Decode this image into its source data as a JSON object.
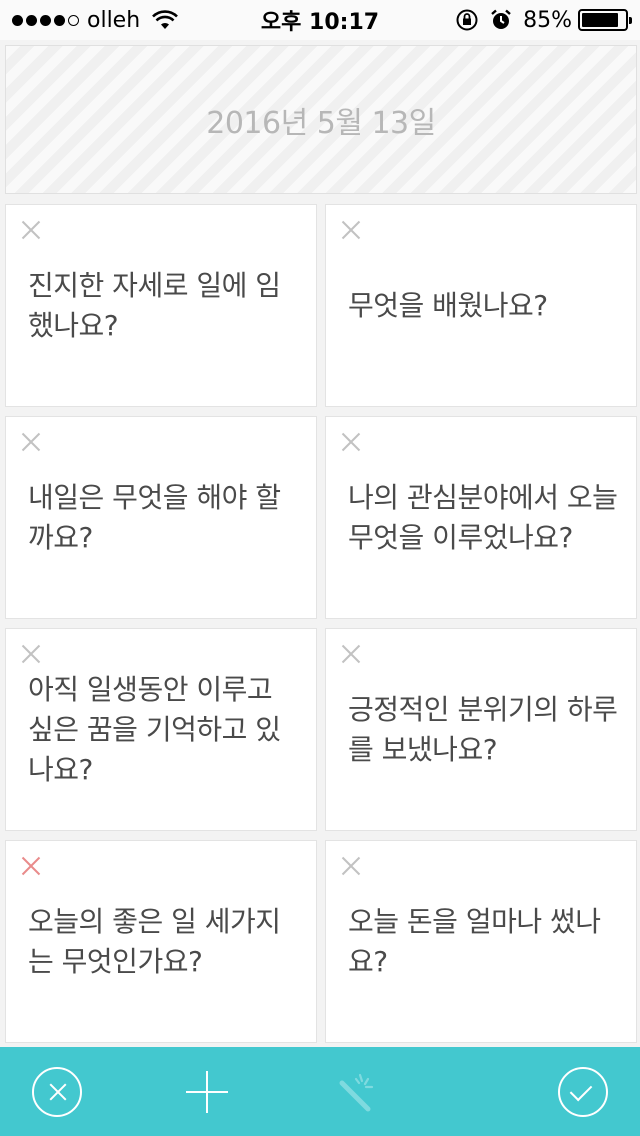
{
  "status_bar": {
    "carrier": "olleh",
    "time": "오후 10:17",
    "battery_percent": "85%",
    "battery_level": 0.85,
    "signal_bars_filled": 4,
    "signal_bars_total": 5
  },
  "date_banner": {
    "date": "2016년 5월 13일"
  },
  "questions": [
    {
      "text": "진지한 자세로 일에 임했나요?"
    },
    {
      "text": "무엇을 배웠나요?"
    },
    {
      "text": "내일은 무엇을 해야 할까요?"
    },
    {
      "text": "나의 관심분야에서 오늘 무엇을 이루었나요?"
    },
    {
      "text": "아직 일생동안 이루고 싶은 꿈을 기억하고 있나요?"
    },
    {
      "text": "긍정적인 분위기의 하루를 보냈나요?"
    },
    {
      "text": "오늘의 좋은 일 세가지는 무엇인가요?"
    },
    {
      "text": "오늘 돈을 얼마나 썼나요?"
    }
  ],
  "icons": {
    "card_delete": "close-icon",
    "cancel": "cancel-circle-icon",
    "add": "plus-icon",
    "magic": "magic-wand-icon",
    "confirm": "check-circle-icon"
  },
  "colors": {
    "accent": "#43c8cf",
    "delete_active": "#e98b8b",
    "delete_inactive": "#c2c2c2",
    "question_text": "#4a4a4a",
    "date_text": "#b7b7b7"
  }
}
